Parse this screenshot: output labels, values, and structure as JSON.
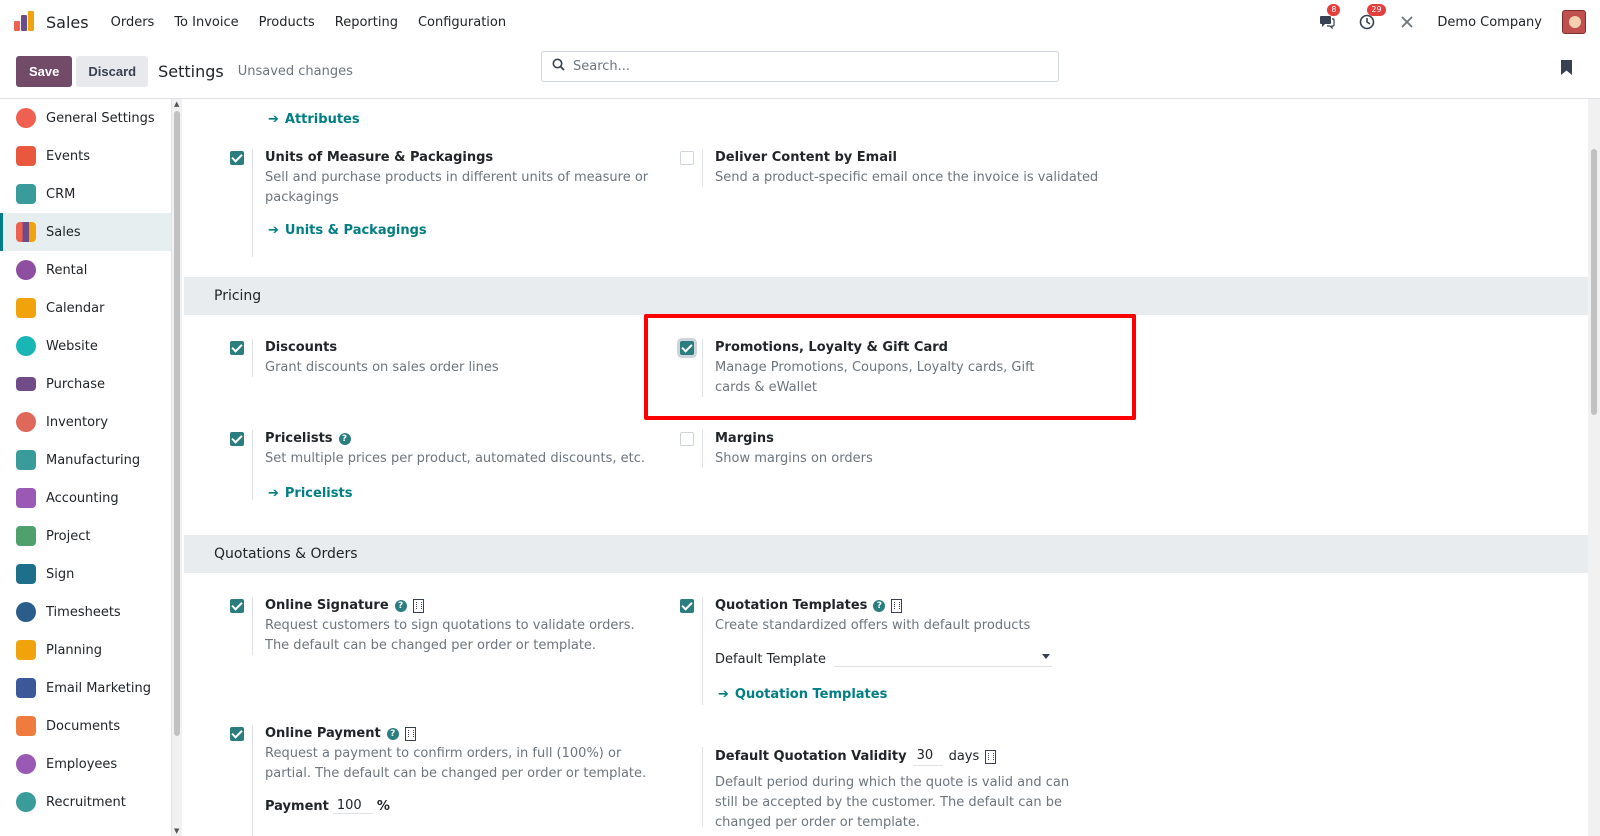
{
  "navbar": {
    "brand": "Sales",
    "menu": [
      "Orders",
      "To Invoice",
      "Products",
      "Reporting",
      "Configuration"
    ],
    "messages_badge": "8",
    "activities_badge": "29",
    "company": "Demo Company"
  },
  "controlbar": {
    "save_label": "Save",
    "discard_label": "Discard",
    "title": "Settings",
    "status": "Unsaved changes",
    "search_placeholder": "Search..."
  },
  "sidebar": {
    "items": [
      {
        "label": "General Settings",
        "color": "#f06050"
      },
      {
        "label": "Events",
        "color": "#e9573f"
      },
      {
        "label": "CRM",
        "color": "#3a9b9b"
      },
      {
        "label": "Sales",
        "color": "#e9573f",
        "active": true
      },
      {
        "label": "Rental",
        "color": "#8f4fa0"
      },
      {
        "label": "Calendar",
        "color": "#f0a30a"
      },
      {
        "label": "Website",
        "color": "#1ab5b5"
      },
      {
        "label": "Purchase",
        "color": "#6f4b87"
      },
      {
        "label": "Inventory",
        "color": "#e0685a"
      },
      {
        "label": "Manufacturing",
        "color": "#3a9b9b"
      },
      {
        "label": "Accounting",
        "color": "#9b59b6"
      },
      {
        "label": "Project",
        "color": "#4fa06d"
      },
      {
        "label": "Sign",
        "color": "#1e6f8a"
      },
      {
        "label": "Timesheets",
        "color": "#2a5d8c"
      },
      {
        "label": "Planning",
        "color": "#f0a30a"
      },
      {
        "label": "Email Marketing",
        "color": "#3b5998"
      },
      {
        "label": "Documents",
        "color": "#f07b3f"
      },
      {
        "label": "Employees",
        "color": "#9b59b6"
      },
      {
        "label": "Recruitment",
        "color": "#3a9b9b"
      }
    ]
  },
  "content": {
    "attributes_link": "Attributes",
    "uom": {
      "title": "Units of Measure & Packagings",
      "desc": "Sell and purchase products in different units of measure or packagings",
      "link": "Units & Packagings"
    },
    "deliver": {
      "title": "Deliver Content by Email",
      "desc": "Send a product-specific email once the invoice is validated"
    },
    "pricing_section": "Pricing",
    "discounts": {
      "title": "Discounts",
      "desc": "Grant discounts on sales order lines"
    },
    "promotions": {
      "title": "Promotions, Loyalty & Gift Card",
      "desc": "Manage Promotions, Coupons, Loyalty cards, Gift cards & eWallet"
    },
    "pricelists": {
      "title": "Pricelists",
      "desc": "Set multiple prices per product, automated discounts, etc.",
      "link": "Pricelists"
    },
    "margins": {
      "title": "Margins",
      "desc": "Show margins on orders"
    },
    "quotations_section": "Quotations & Orders",
    "online_signature": {
      "title": "Online Signature",
      "desc": "Request customers to sign quotations to validate orders. The default can be changed per order or template."
    },
    "quotation_templates": {
      "title": "Quotation Templates",
      "desc": "Create standardized offers with default products",
      "default_label": "Default Template",
      "link": "Quotation Templates"
    },
    "online_payment": {
      "title": "Online Payment",
      "desc": "Request a payment to confirm orders, in full (100%) or partial. The default can be changed per order or template.",
      "payment_label": "Payment",
      "payment_value": "100",
      "payment_unit": "%"
    },
    "validity": {
      "title": "Default Quotation Validity",
      "value": "30",
      "unit": "days",
      "desc": "Default period during which the quote is valid and can still be accepted by the customer. The default can be changed per order or template."
    }
  }
}
